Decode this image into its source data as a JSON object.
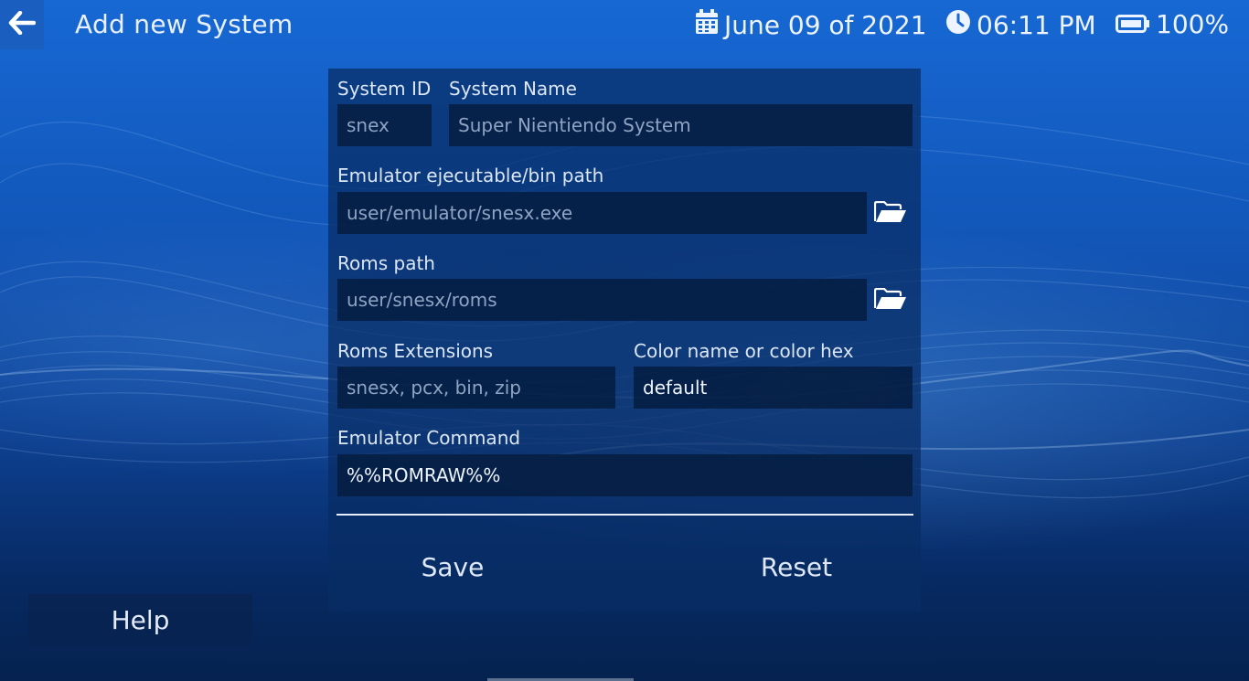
{
  "header": {
    "title": "Add new System",
    "date": "June 09 of 2021",
    "time": "06:11 PM",
    "battery": "100%"
  },
  "form": {
    "system_id": {
      "label": "System ID",
      "placeholder": "snex"
    },
    "system_name": {
      "label": "System Name",
      "placeholder": "Super Nientiendo System"
    },
    "emulator_path": {
      "label": "Emulator ejecutable/bin path",
      "placeholder": "user/emulator/snesx.exe"
    },
    "roms_path": {
      "label": "Roms path",
      "placeholder": "user/snesx/roms"
    },
    "roms_extensions": {
      "label": "Roms Extensions",
      "placeholder": "snesx, pcx, bin, zip"
    },
    "color": {
      "label": "Color name or color hex",
      "value": "default"
    },
    "emulator_command": {
      "label": "Emulator Command",
      "value": "%%ROMRAW%%"
    }
  },
  "actions": {
    "save_label": "Save",
    "reset_label": "Reset"
  },
  "help_label": "Help",
  "colors": {
    "accent": "#1a5fbf",
    "panel": "#082d64",
    "field": "#051c3e"
  },
  "icons": {
    "back": "arrow-left-icon",
    "date": "calendar-icon",
    "time": "clock-icon",
    "battery": "battery-icon",
    "browse": "folder-open-icon"
  }
}
